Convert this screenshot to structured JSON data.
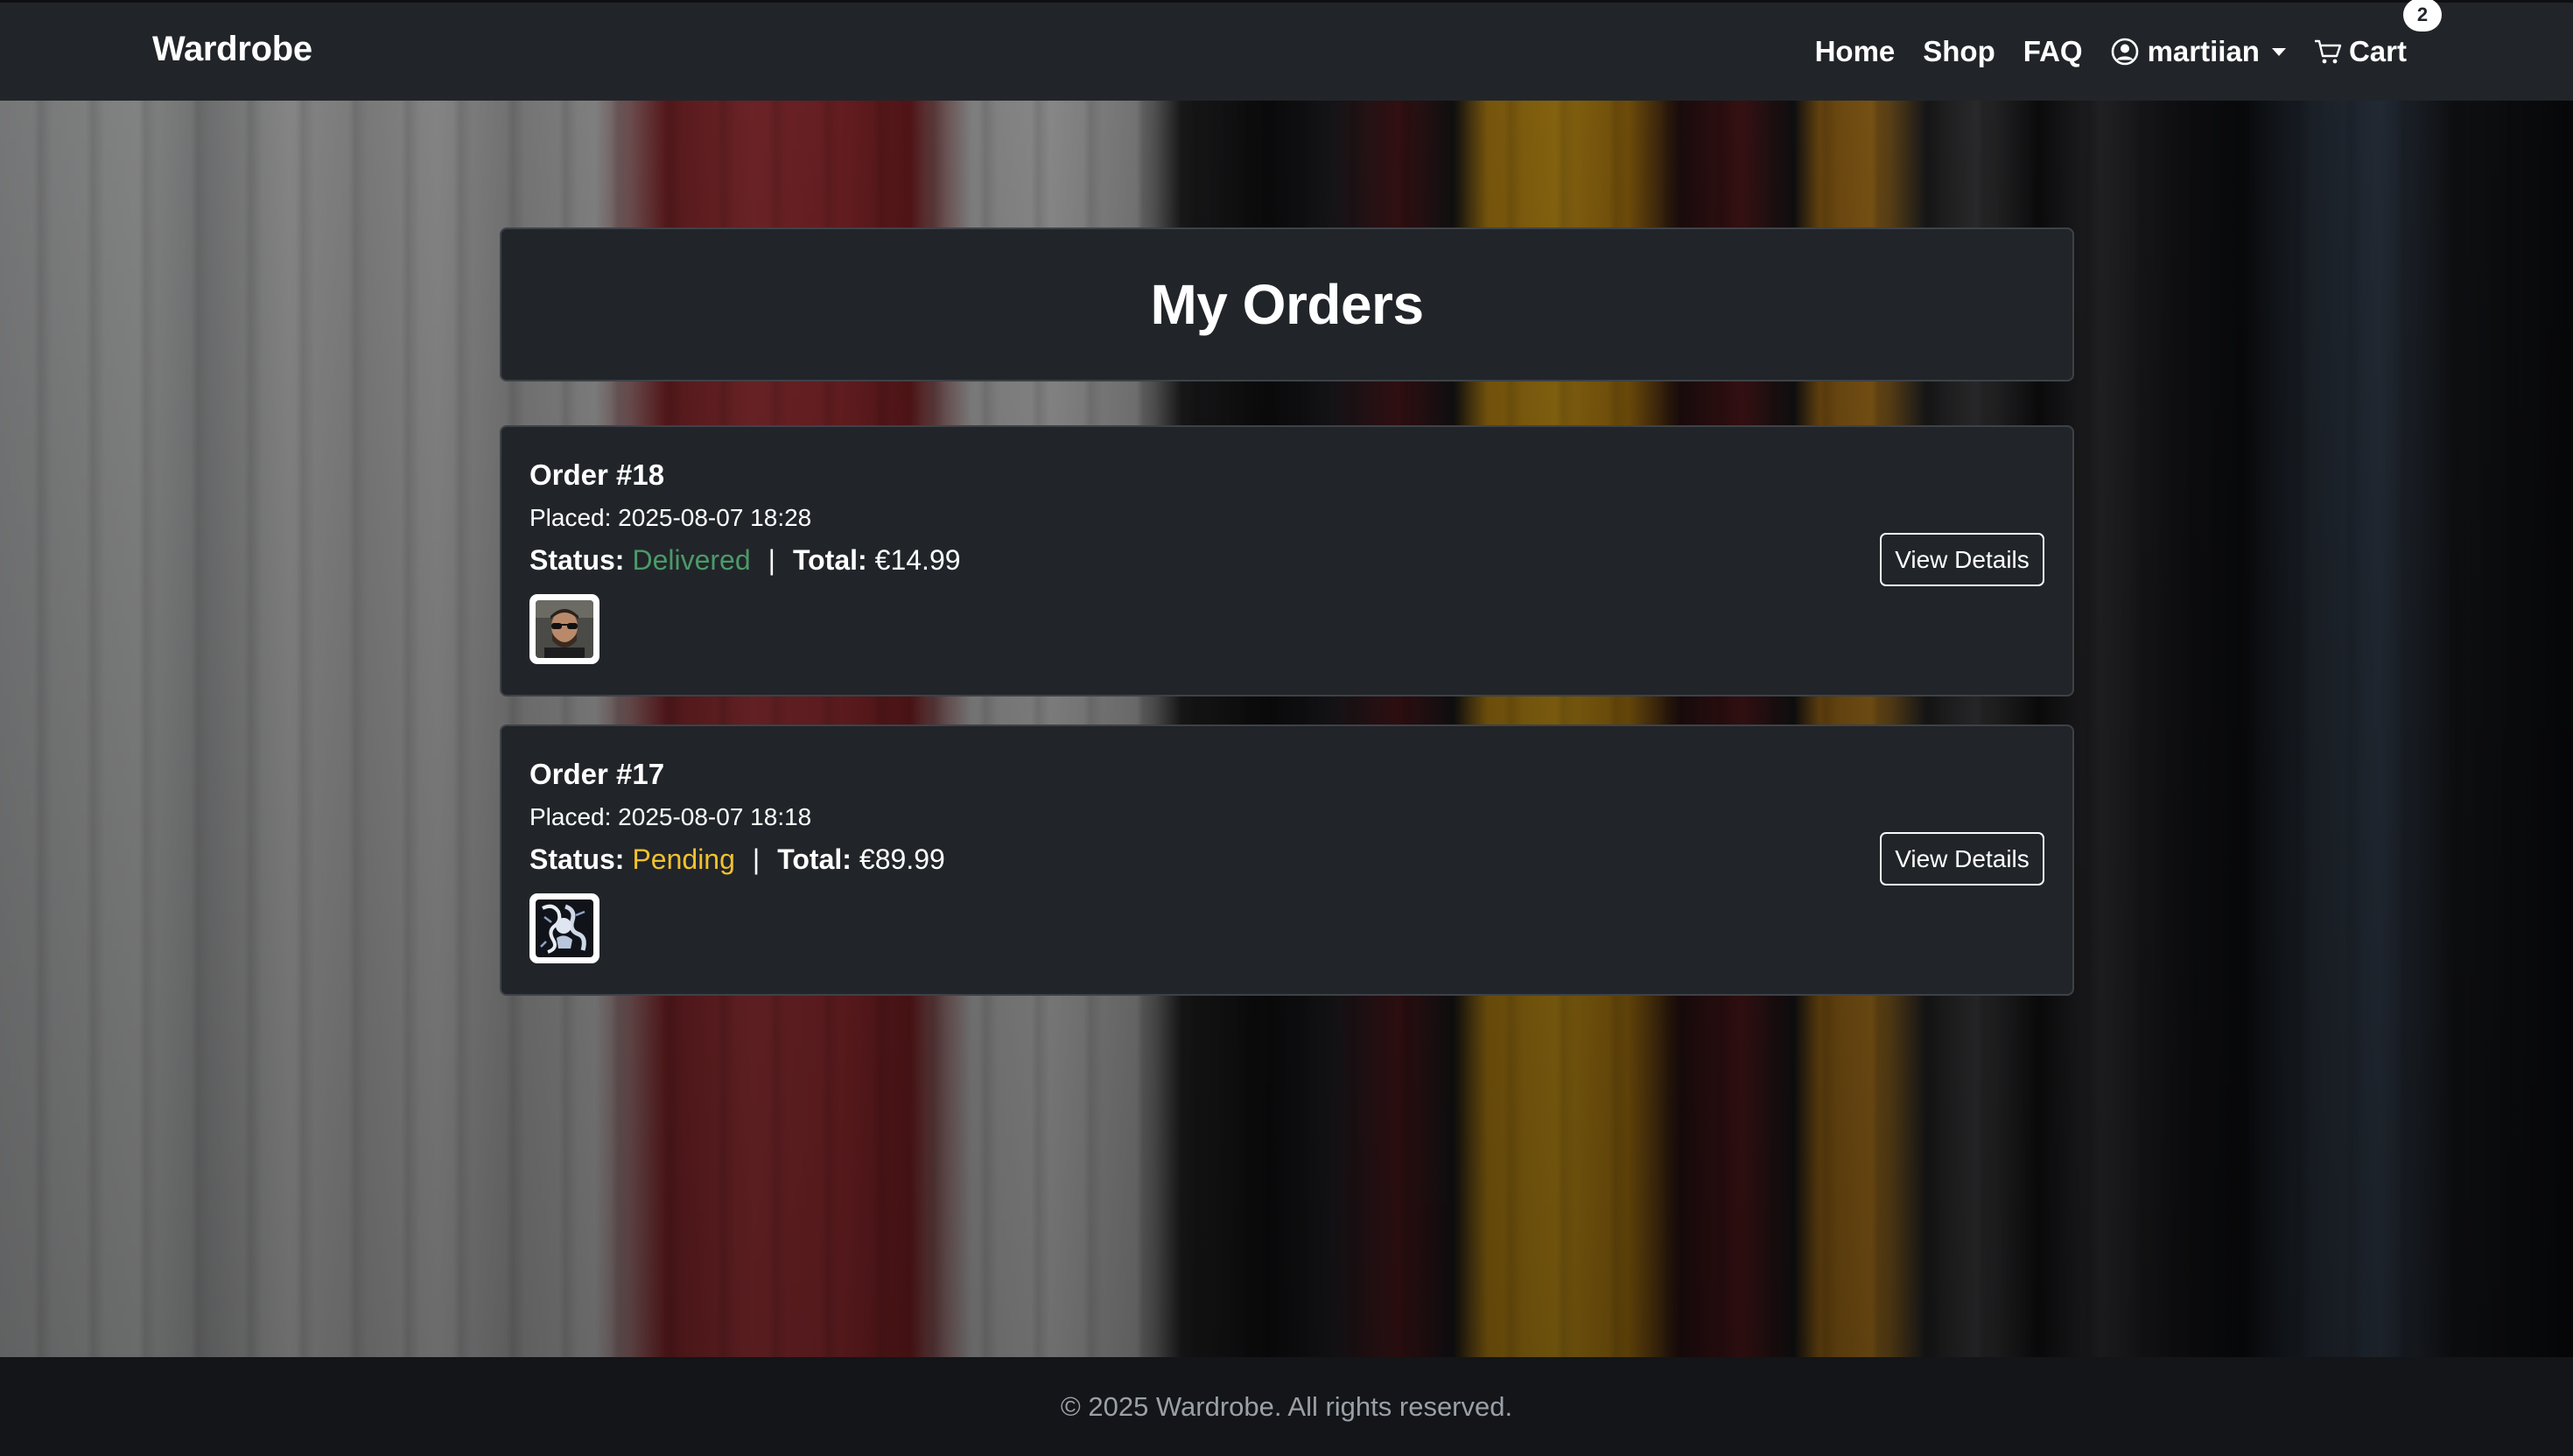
{
  "navbar": {
    "brand": "Wardrobe",
    "links": {
      "home": "Home",
      "shop": "Shop",
      "faq": "FAQ",
      "user": "martiian",
      "cart": "Cart",
      "cart_count": "2"
    },
    "icons": {
      "user": "person-circle-icon",
      "caret": "caret-down-icon",
      "cart": "cart-icon"
    }
  },
  "page": {
    "title": "My Orders"
  },
  "orders": [
    {
      "title": "Order #18",
      "placed": "Placed: 2025-08-07 18:28",
      "status_label": "Status:",
      "status": "Delivered",
      "total_label": "Total:",
      "total": "€14.99",
      "separator": "|",
      "button": "View Details",
      "status_color": "#4c9a68"
    },
    {
      "title": "Order #17",
      "placed": "Placed: 2025-08-07 18:18",
      "status_label": "Status:",
      "status": "Pending",
      "total_label": "Total:",
      "total": "€89.99",
      "separator": "|",
      "button": "View Details",
      "status_color": "#f2c12e"
    }
  ],
  "footer": {
    "text": "© 2025 Wardrobe. All rights reserved."
  },
  "colors": {
    "navbar": "#212529",
    "card": "#212529",
    "footer": "#131518"
  }
}
